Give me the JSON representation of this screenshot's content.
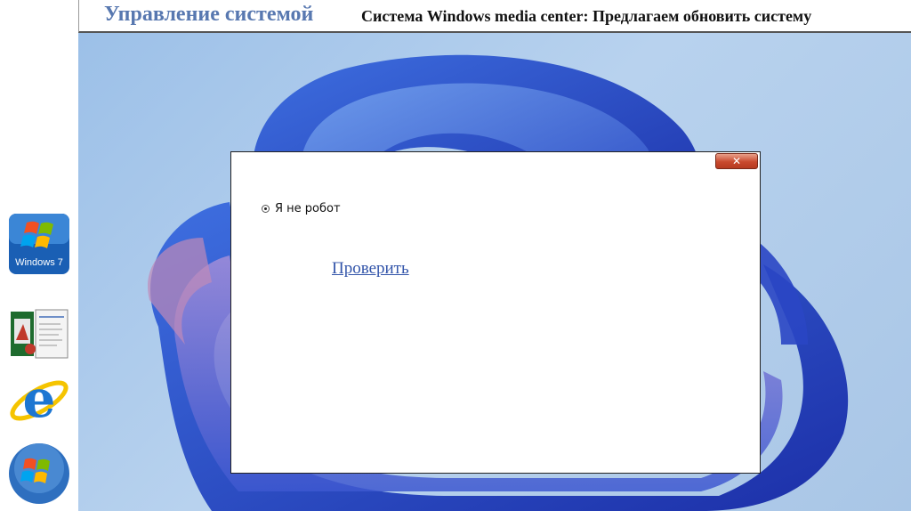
{
  "header": {
    "title": "Управление системой",
    "subtitle": "Система Windows media center: Предлагаем обновить систему"
  },
  "sidebar": {
    "icons": [
      "windows-7-logo-icon",
      "software-box-icon",
      "internet-explorer-icon",
      "windows-orb-icon"
    ],
    "win7_label": "Windows 7"
  },
  "dialog": {
    "close_label": "✕",
    "checkbox_label": "Я не робот",
    "verify_link": "Проверить"
  },
  "colors": {
    "title": "#5878b0",
    "link": "#3355aa",
    "close_button": "#c94a2e",
    "wallpaper": "#a9c6e6"
  }
}
